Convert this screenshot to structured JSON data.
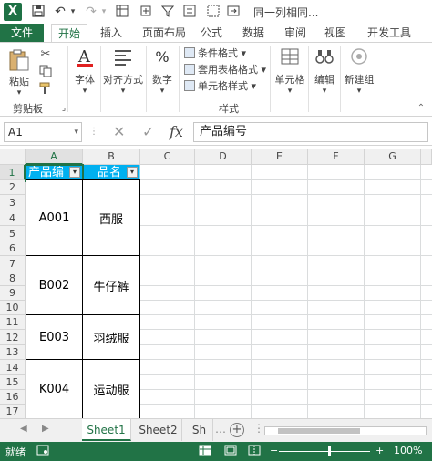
{
  "app": {
    "logo": "X",
    "title": "同一列相同..."
  },
  "qat": {
    "icons": [
      "save-icon",
      "undo-icon",
      "redo-icon",
      "qat-icon-1",
      "qat-icon-2",
      "qat-icon-3",
      "qat-icon-4",
      "qat-icon-5"
    ]
  },
  "tabs": {
    "file": "文件",
    "items": [
      "开始",
      "插入",
      "页面布局",
      "公式",
      "数据",
      "审阅",
      "视图",
      "开发工具"
    ],
    "active": "开始"
  },
  "ribbon": {
    "clipboard": {
      "paste": "粘贴",
      "group": "剪贴板"
    },
    "font": {
      "label": "字体",
      "icon_glyph": "A"
    },
    "alignment": {
      "label": "对齐方式"
    },
    "number": {
      "label": "数字",
      "icon_glyph": "%"
    },
    "styles": {
      "conditional": "条件格式",
      "table": "套用表格格式",
      "cell": "单元格样式",
      "group": "样式"
    },
    "cells": {
      "label": "单元格"
    },
    "editing": {
      "label": "编辑"
    },
    "new_group": {
      "label": "新建组"
    }
  },
  "formula_bar": {
    "name_box": "A1",
    "cancel_glyph": "✕",
    "enter_glyph": "✓",
    "fx": "fx",
    "value": "产品编号"
  },
  "grid": {
    "columns": [
      "A",
      "B",
      "C",
      "D",
      "E",
      "F",
      "G"
    ],
    "rows": [
      "1",
      "2",
      "3",
      "4",
      "5",
      "6",
      "7",
      "8",
      "9",
      "10",
      "11",
      "12",
      "13",
      "14",
      "15",
      "16",
      "17"
    ],
    "selected_column": "A",
    "selected_row": "1",
    "header_cells": [
      "产品编",
      "品名"
    ],
    "filter_glyph": "▾",
    "merged_blocks": [
      {
        "id": "A001",
        "name": "西服"
      },
      {
        "id": "B002",
        "name": "牛仔裤"
      },
      {
        "id": "E003",
        "name": "羽绒服"
      },
      {
        "id": "K004",
        "name": "运动服"
      }
    ]
  },
  "sheets": {
    "tabs": [
      "Sheet1",
      "Sheet2",
      "Sh"
    ],
    "active": "Sheet1",
    "add_glyph": "+",
    "nav_prev": "◀",
    "nav_next": "▶"
  },
  "status": {
    "ready": "就绪",
    "zoom": "100%",
    "zoom_out": "−",
    "zoom_in": "+"
  },
  "colors": {
    "brand_green": "#217346",
    "header_fill": "#00b0f0"
  }
}
